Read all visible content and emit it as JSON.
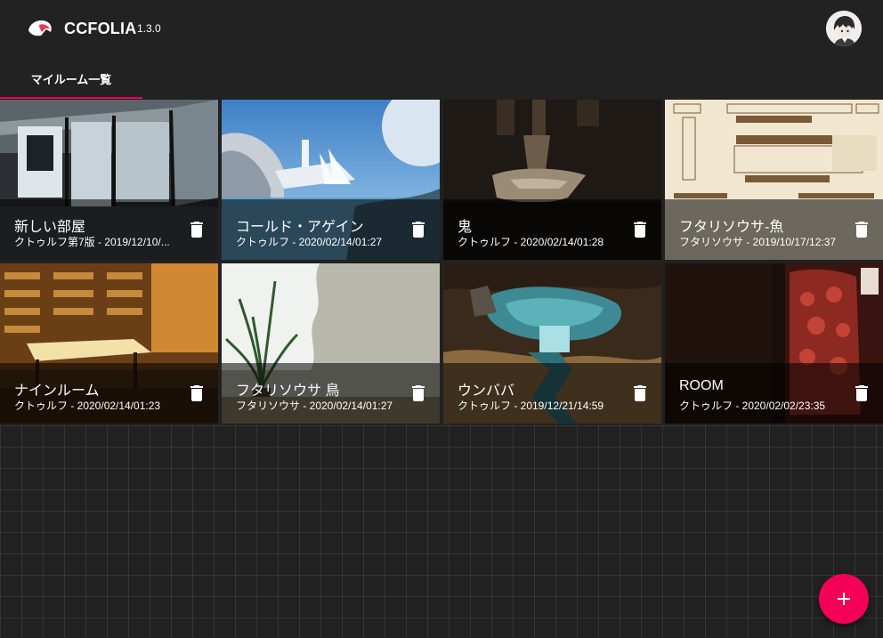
{
  "app": {
    "brand": "CCFOLIA",
    "version": "1.3.0",
    "accent_color": "#f50057"
  },
  "tabs": [
    {
      "label": "マイルーム一覧",
      "active": true
    }
  ],
  "rooms": [
    {
      "name": "新しい部屋",
      "subtitle": "クトゥルフ第7版 - 2019/12/10/...",
      "theme": "cabin"
    },
    {
      "name": "コールド・アゲイン",
      "subtitle": "クトゥルフ - 2020/02/14/01:27",
      "theme": "sky"
    },
    {
      "name": "鬼",
      "subtitle": "クトゥルフ - 2020/02/14/01:28",
      "theme": "dark"
    },
    {
      "name": "フタリソウサ-魚",
      "subtitle": "フタリソウサ - 2019/10/17/12:37",
      "theme": "paper"
    },
    {
      "name": "ナインルーム",
      "subtitle": "クトゥルフ - 2020/02/14/01:23",
      "theme": "library"
    },
    {
      "name": "フタリソウサ 鳥",
      "subtitle": "フタリソウサ - 2020/02/14/01:27",
      "theme": "plant"
    },
    {
      "name": "ウンババ",
      "subtitle": "クトゥルフ - 2019/12/21/14:59",
      "theme": "map"
    },
    {
      "name": "ROOM",
      "subtitle": "クトゥルフ - 2020/02/02/23:35",
      "theme": "red"
    }
  ],
  "icons": {
    "logo": "bird-logo-icon",
    "delete": "trash-icon",
    "add": "plus-icon"
  }
}
